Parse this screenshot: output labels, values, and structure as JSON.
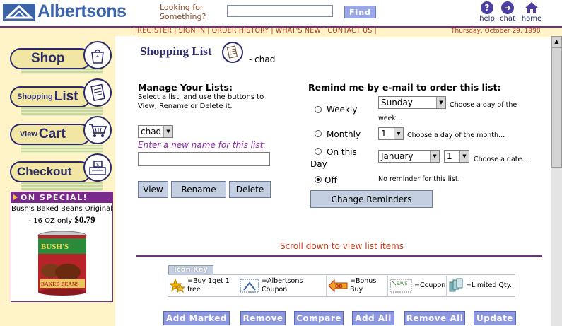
{
  "header": {
    "logo_text": "Albertsons",
    "logo_reg": "®",
    "search_prompt_line1": "Looking for",
    "search_prompt_line2": "Something?",
    "search_value": "",
    "find_label": "Find",
    "help_label": "help",
    "chat_label": "chat",
    "home_label": "home"
  },
  "nav": {
    "links": [
      "REGISTER",
      "SIGN IN",
      "ORDER HISTORY",
      "WHAT'S NEW",
      "CONTACT US"
    ],
    "date": "Thursday, October 29, 1998"
  },
  "sidebar": {
    "shop": "Shop",
    "list_small": "Shopping",
    "list_big": "List",
    "cart_small": "View",
    "cart_big": "Cart",
    "checkout": "Checkout",
    "special_title": "ON SPECIAL!",
    "special_name": "Bush's Baked Beans Original",
    "special_size": "- 16 OZ only",
    "special_price": "$0.79",
    "can_brand": "BUSH'S",
    "can_label": "BAKED BEANS"
  },
  "main": {
    "title": "Shopping List",
    "title_user": "- chad",
    "manage_heading": "Manage Your Lists:",
    "manage_desc": "Select a list, and use the buttons to View, Rename or Delete it.",
    "selected_list": "chad",
    "rename_prompt": "Enter a new name for this list:",
    "rename_value": "",
    "view_label": "View",
    "rename_label": "Rename",
    "delete_label": "Delete",
    "remind_heading": "Remind me by e-mail to order this list:",
    "weekly_label": "Weekly",
    "weekly_day": "Sunday",
    "weekly_hint": "Choose a day of the week...",
    "monthly_label": "Monthly",
    "monthly_day": "1",
    "monthly_hint": "Choose a day of the month...",
    "onthis_label": "On this",
    "day_label": "Day",
    "date_month": "January",
    "date_day": "1",
    "date_hint": "Choose a date...",
    "off_label": "Off",
    "off_hint": "No reminder for this list.",
    "change_label": "Change Reminders",
    "scroll_note": "Scroll down to view list items",
    "selected_reminder": "Off"
  },
  "icon_key": {
    "label": "Icon Key",
    "bogo": "=Buy 1get 1 free",
    "albertsons": "=Albertsons Coupon",
    "bonus": "=Bonus Buy",
    "coupon": "=Coupon",
    "limited": "=Limited Qty.",
    "bb_text": "BB",
    "save_text": "SAVE"
  },
  "actions": {
    "add_marked": "Add Marked",
    "remove": "Remove",
    "compare": "Compare",
    "add_all": "Add All",
    "remove_all": "Remove All",
    "update": "Update"
  },
  "colors": {
    "brand_blue": "#3a63a8",
    "accent_purple": "#7a2a8a",
    "nav_text": "#b23a1f",
    "cream": "#fff4c8",
    "button_blue": "#8e98e0"
  }
}
